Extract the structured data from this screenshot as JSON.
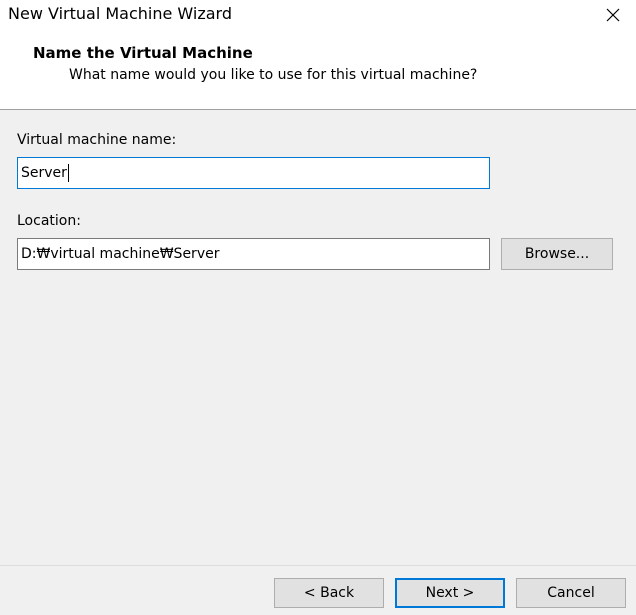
{
  "window": {
    "title": "New Virtual Machine Wizard",
    "close_icon": "close-icon"
  },
  "header": {
    "title": "Name the Virtual Machine",
    "subtitle": "What name would you like to use for this virtual machine?"
  },
  "form": {
    "name_label": "Virtual machine name:",
    "name_value": "Server",
    "location_label": "Location:",
    "location_value": "D:₩virtual machine₩Server",
    "browse_label": "Browse..."
  },
  "footer": {
    "back_label": "< Back",
    "next_label": "Next >",
    "cancel_label": "Cancel"
  },
  "colors": {
    "focus_border": "#0078d7",
    "background": "#f0f0f0"
  }
}
